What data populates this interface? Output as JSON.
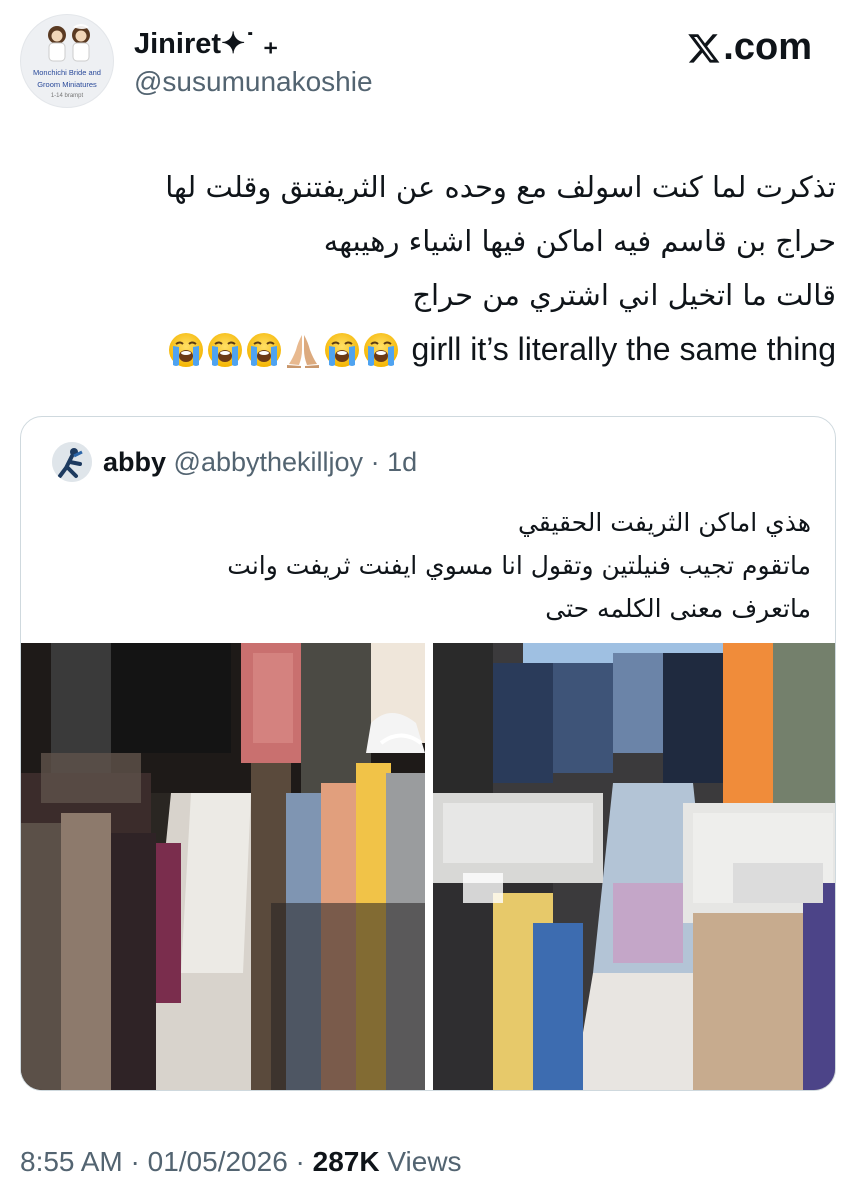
{
  "author": {
    "display_name": "Jiniret",
    "name_decoration": "✦˙ ₊",
    "handle": "@susumunakoshie",
    "avatar_caption_line1": "Monchichi Bride and",
    "avatar_caption_line2": "Groom Miniatures",
    "avatar_caption_line3": "1-14  brampt"
  },
  "brand": {
    "label": ".com",
    "icon": "x-logo-icon"
  },
  "tweet": {
    "lines": [
      "تذكرت لما كنت اسولف مع وحده عن الثريفتنق وقلت لها",
      "حراج بن قاسم فيه اماكن فيها اشياء رهيبهه",
      "قالت ما اتخيل اني اشتري من حراج"
    ],
    "last_line_text": "girll it’s literally the same thing",
    "emojis": [
      "loudly-crying-face-icon",
      "loudly-crying-face-icon",
      "loudly-crying-face-icon",
      "folded-hands-icon",
      "loudly-crying-face-icon",
      "loudly-crying-face-icon"
    ]
  },
  "quoted_tweet": {
    "name": "abby",
    "handle": "@abbythekilljoy",
    "separator": " · ",
    "age": "1d",
    "lines": [
      "هذي اماكن الثريفت الحقيقي",
      "ماتقوم تجيب فنيلتين وتقول انا مسوي ايفنت ثريفت وانت",
      "ماتعرف معنى الكلمه حتى"
    ],
    "images": [
      "thrift-store-aisle-photo",
      "thrift-store-shoes-and-clothes-photo"
    ]
  },
  "footer": {
    "time": "8:55 AM",
    "separator": " · ",
    "date": "01/05/2026",
    "views_count": "287K",
    "views_label": " Views"
  },
  "colors": {
    "text_primary": "#0f1419",
    "text_secondary": "#536471",
    "border": "#cfd9de"
  }
}
